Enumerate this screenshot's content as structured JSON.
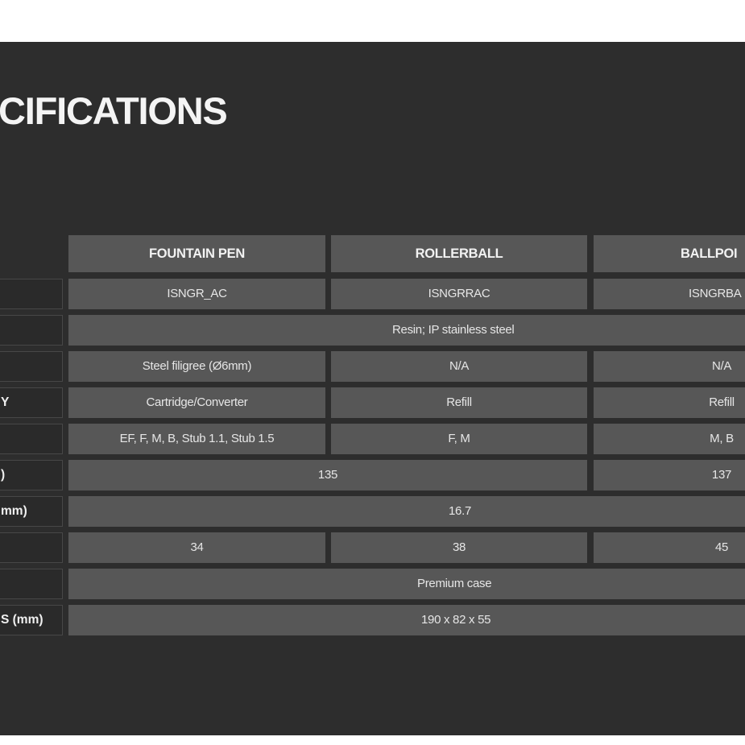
{
  "title": "CIFICATIONS",
  "columns": [
    "FOUNTAIN PEN",
    "ROLLERBALL",
    "BALLPOI"
  ],
  "row_labels": [
    "",
    "",
    "",
    "Y",
    "",
    ")",
    "mm)",
    "",
    "",
    "S (mm)"
  ],
  "rows": {
    "code": [
      "ISNGR_AC",
      "ISNGRRAC",
      "ISNGRBA"
    ],
    "material": "Resin; IP stainless steel",
    "filigree": [
      "Steel filigree (Ø6mm)",
      "N/A",
      "N/A"
    ],
    "filling": [
      "Cartridge/Converter",
      "Refill",
      "Refill"
    ],
    "nibs": [
      "EF, F, M, B, Stub 1.1, Stub 1.5",
      "F, M",
      "M, B"
    ],
    "length": [
      "135",
      "137"
    ],
    "diameter": "16.7",
    "weight": [
      "34",
      "38",
      "45"
    ],
    "packaging": "Premium case",
    "box_dimensions": "190 x 82 x 55"
  },
  "colors": {
    "panel": "#2d2d2d",
    "cell": "#575757",
    "label_cell": "#2a2a2a",
    "text": "#e6e6e6"
  }
}
